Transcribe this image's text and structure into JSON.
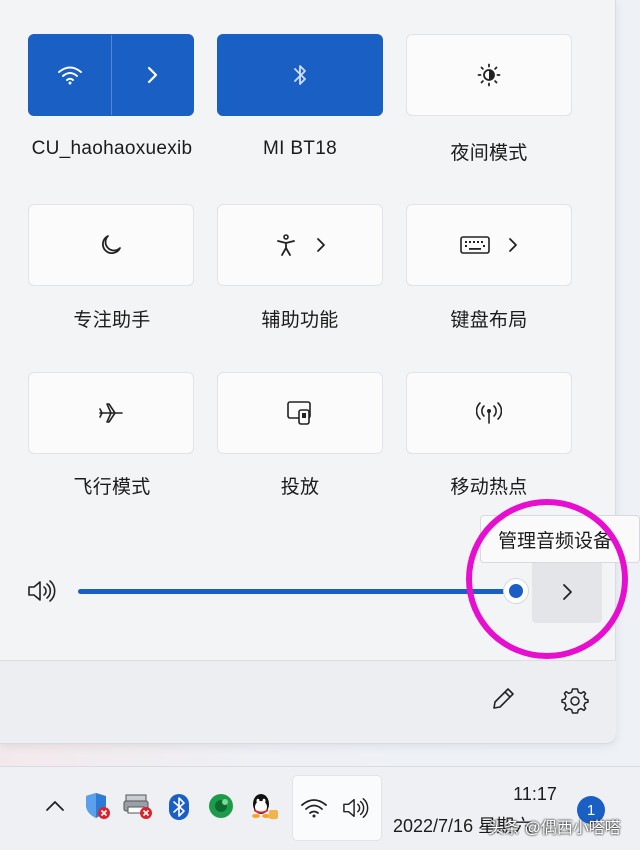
{
  "quick_settings": {
    "tiles": [
      {
        "label": "CU_haohaoxuexib",
        "icon": "wifi-icon",
        "active": true,
        "has_chevron": true
      },
      {
        "label": "MI BT18",
        "icon": "bluetooth-icon",
        "active": true,
        "has_chevron": false
      },
      {
        "label": "夜间模式",
        "icon": "night-light-icon",
        "active": false,
        "has_chevron": false
      },
      {
        "label": "专注助手",
        "icon": "moon-icon",
        "active": false,
        "has_chevron": false
      },
      {
        "label": "辅助功能",
        "icon": "accessibility-icon",
        "active": false,
        "has_chevron": true
      },
      {
        "label": "键盘布局",
        "icon": "keyboard-icon",
        "active": false,
        "has_chevron": true
      },
      {
        "label": "飞行模式",
        "icon": "airplane-icon",
        "active": false,
        "has_chevron": false
      },
      {
        "label": "投放",
        "icon": "cast-icon",
        "active": false,
        "has_chevron": false
      },
      {
        "label": "移动热点",
        "icon": "hotspot-icon",
        "active": false,
        "has_chevron": false
      }
    ],
    "volume": {
      "level": 1.0,
      "icon": "speaker-icon"
    },
    "audio_tooltip": "管理音频设备",
    "footer": {
      "edit_icon": "pencil-icon",
      "settings_icon": "gear-icon"
    }
  },
  "taskbar": {
    "tray_icons": [
      "chevron-up-icon",
      "security-shield-icon",
      "printer-error-icon",
      "bluetooth-icon",
      "app-green-icon",
      "qq-icon"
    ],
    "network_icons": [
      "wifi-icon",
      "speaker-icon"
    ],
    "time": "11:17",
    "date": "2022/7/16 星期六",
    "notification_count": "1"
  },
  "watermark": "头条 @偶西小嗒嗒",
  "colors": {
    "accent": "#1a5fc4",
    "highlight": "#e60fd0",
    "panel": "#f3f4f6"
  }
}
